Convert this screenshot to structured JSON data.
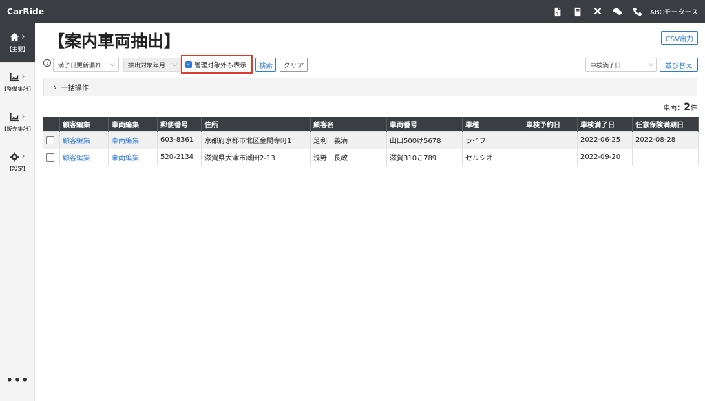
{
  "app": {
    "brand": "CarRide",
    "company": "ABCモータース"
  },
  "topbar_icons": [
    "invoice-icon",
    "book-icon",
    "tools-icon",
    "chat-icon",
    "phone-icon"
  ],
  "sidebar": {
    "items": [
      {
        "label": "【主要】",
        "icon": "home-icon",
        "active": true
      },
      {
        "label": "【整備集計】",
        "icon": "chart-icon",
        "active": false
      },
      {
        "label": "【販売集計】",
        "icon": "chart-icon",
        "active": false
      },
      {
        "label": "【設定】",
        "icon": "gear-icon",
        "active": false
      }
    ],
    "more": "•••"
  },
  "page": {
    "title": "【案内車両抽出】",
    "csv_button": "CSV出力"
  },
  "filters": {
    "help": "?",
    "select1": "満了日更新漏れ",
    "select2": "抽出対象年月",
    "include_unmanaged_label": "管理対象外も表示",
    "include_unmanaged_checked": true,
    "search_button": "検索",
    "clear_button": "クリア",
    "sort_select": "車検満了日",
    "sort_button": "並び替え"
  },
  "bulk": {
    "label": "一括操作"
  },
  "count": {
    "prefix": "車両：",
    "value": "2",
    "suffix": "件"
  },
  "table": {
    "headers": [
      "",
      "顧客編集",
      "車両編集",
      "郵便番号",
      "住所",
      "顧客名",
      "車両番号",
      "車種",
      "車検予約日",
      "車検満了日",
      "任意保険満期日"
    ],
    "rows": [
      {
        "customer_edit": "顧客編集",
        "vehicle_edit": "車両編集",
        "postal": "603-8361",
        "address": "京都府京都市北区金閣寺町1",
        "name": "足利　義満",
        "plate": "山口500け5678",
        "model": "ライフ",
        "reservation": "",
        "inspection_expiry": "2022-06-25",
        "insurance_expiry": "2022-08-28"
      },
      {
        "customer_edit": "顧客編集",
        "vehicle_edit": "車両編集",
        "postal": "520-2134",
        "address": "滋賀県大津市瀬田2-13",
        "name": "浅野　長政",
        "plate": "滋賀310こ789",
        "model": "セルシオ",
        "reservation": "",
        "inspection_expiry": "2022-09-20",
        "insurance_expiry": ""
      }
    ]
  }
}
